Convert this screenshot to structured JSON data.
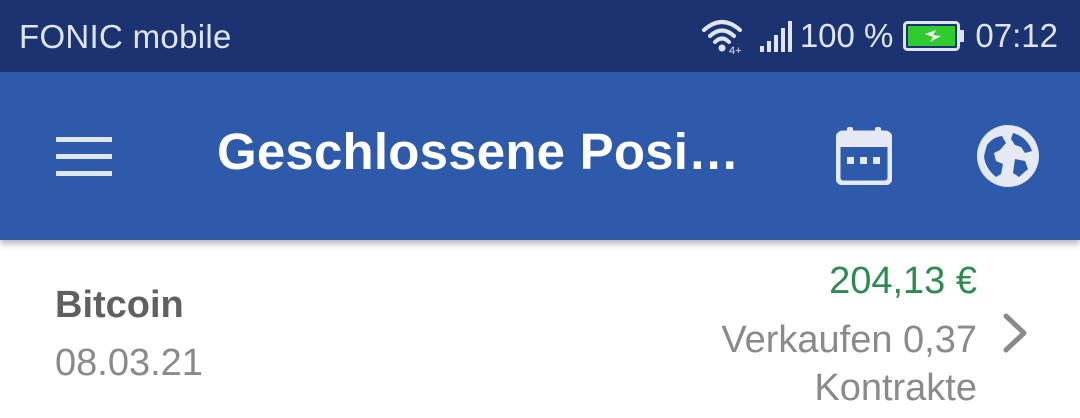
{
  "status_bar": {
    "carrier": "FONIC mobile",
    "wifi_badge": "4+",
    "battery_percent": "100 %",
    "time": "07:12",
    "icons": [
      "wifi-icon",
      "signal-icon",
      "battery-charging-icon"
    ],
    "battery_color": "#2ecc2e"
  },
  "app_bar": {
    "title": "Geschlossene Posi…",
    "menu_icon": "hamburger-menu-icon",
    "calendar_icon": "calendar-icon",
    "globe_icon": "globe-icon",
    "background": "#2e5aac"
  },
  "positions": [
    {
      "name": "Bitcoin",
      "date": "08.03.21",
      "amount": "204,13 €",
      "action": "Verkaufen 0,37 Kontrakte",
      "amount_color": "#2e8b4f"
    }
  ]
}
